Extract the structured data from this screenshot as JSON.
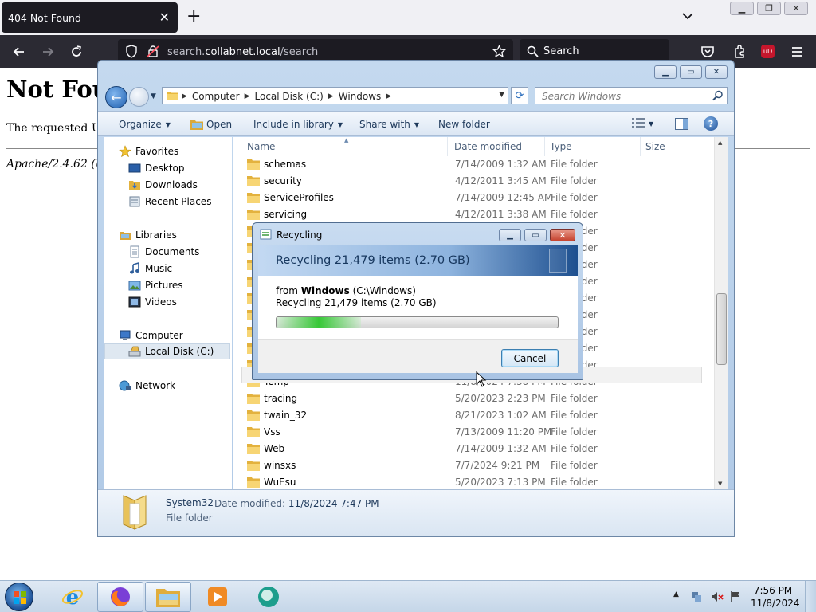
{
  "browser": {
    "tab_title": "404 Not Found",
    "url_prefix": "search.",
    "url_domain": "collabnet.local",
    "url_path": "/search",
    "search_placeholder": "Search"
  },
  "page": {
    "heading": "Not Foun",
    "message": "The requested UR",
    "address": "Apache/2.4.62 (U"
  },
  "explorer": {
    "breadcrumbs": [
      "Computer",
      "Local Disk (C:)",
      "Windows"
    ],
    "search_placeholder": "Search Windows",
    "commands": {
      "organize": "Organize",
      "open": "Open",
      "include": "Include in library",
      "share": "Share with",
      "new_folder": "New folder"
    },
    "nav": {
      "favorites": "Favorites",
      "desktop": "Desktop",
      "downloads": "Downloads",
      "recent": "Recent Places",
      "libraries": "Libraries",
      "documents": "Documents",
      "music": "Music",
      "pictures": "Pictures",
      "videos": "Videos",
      "computer": "Computer",
      "local_disk": "Local Disk (C:)",
      "network": "Network"
    },
    "columns": {
      "name": "Name",
      "date": "Date modified",
      "type": "Type",
      "size": "Size"
    },
    "rows": [
      {
        "name": "schemas",
        "date": "7/14/2009 1:32 AM",
        "type": "File folder"
      },
      {
        "name": "security",
        "date": "4/12/2011 3:45 AM",
        "type": "File folder"
      },
      {
        "name": "ServiceProfiles",
        "date": "7/14/2009 12:45 AM",
        "type": "File folder"
      },
      {
        "name": "servicing",
        "date": "4/12/2011 3:38 AM",
        "type": "File folder"
      },
      {
        "name": "",
        "date": "",
        "type": "File folder"
      },
      {
        "name": "",
        "date": "",
        "type": "File folder"
      },
      {
        "name": "",
        "date": "",
        "type": "File folder"
      },
      {
        "name": "",
        "date": "",
        "type": "File folder"
      },
      {
        "name": "",
        "date": "",
        "type": "File folder"
      },
      {
        "name": "",
        "date": "",
        "type": "File folder"
      },
      {
        "name": "",
        "date": "",
        "type": "File folder"
      },
      {
        "name": "",
        "date": "",
        "type": "File folder"
      },
      {
        "name": "",
        "date": "",
        "type": "File folder"
      },
      {
        "name": "Temp",
        "date": "11/8/2024 7:38 PM",
        "type": "File folder"
      },
      {
        "name": "tracing",
        "date": "5/20/2023 2:23 PM",
        "type": "File folder"
      },
      {
        "name": "twain_32",
        "date": "8/21/2023 1:02 AM",
        "type": "File folder"
      },
      {
        "name": "Vss",
        "date": "7/13/2009 11:20 PM",
        "type": "File folder"
      },
      {
        "name": "Web",
        "date": "7/14/2009 1:32 AM",
        "type": "File folder"
      },
      {
        "name": "winsxs",
        "date": "7/7/2024 9:21 PM",
        "type": "File folder"
      },
      {
        "name": "WuEsu",
        "date": "5/20/2023 7:13 PM",
        "type": "File folder"
      }
    ],
    "details": {
      "name": "System32",
      "date_label": "Date modified:",
      "date_value": "11/8/2024 7:47 PM",
      "type": "File folder"
    }
  },
  "dialog": {
    "title": "Recycling",
    "header": "Recycling 21,479 items (2.70 GB)",
    "from_prefix": "from",
    "from_name": "Windows",
    "from_path": "(C:\\Windows)",
    "line2": "Recycling 21,479 items (2.70 GB)",
    "progress_fraction": 0.3,
    "cancel_label": "Cancel"
  },
  "taskbar": {
    "time": "7:56 PM",
    "date": "11/8/2024"
  }
}
